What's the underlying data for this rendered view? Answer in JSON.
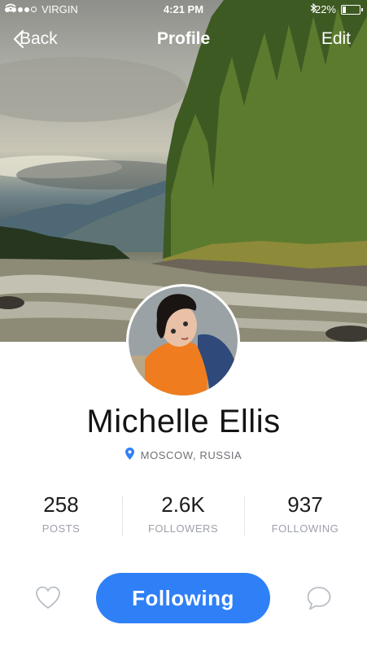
{
  "status_bar": {
    "carrier": "VIRGIN",
    "time": "4:21 PM",
    "battery": "22%",
    "battery_level": 0.22,
    "signal_dots_filled": 4,
    "signal_dots_total": 5,
    "icons": [
      "wifi-icon",
      "bluetooth-icon",
      "battery-icon"
    ]
  },
  "navbar": {
    "back_label": "Back",
    "title": "Profile",
    "edit_label": "Edit",
    "back_icon": "chevron-left-icon"
  },
  "profile": {
    "name": "Michelle Ellis",
    "location": "MOSCOW, RUSSIA",
    "location_icon": "map-pin-icon"
  },
  "stats": [
    {
      "value": "258",
      "label": "POSTS"
    },
    {
      "value": "2.6K",
      "label": "FOLLOWERS"
    },
    {
      "value": "937",
      "label": "FOLLOWING"
    }
  ],
  "actions": {
    "follow_label": "Following",
    "like_icon": "heart-icon",
    "message_icon": "chat-bubble-icon"
  },
  "colors": {
    "accent": "#2f80f6",
    "name_text": "#141414",
    "muted_text": "#9da1aa"
  }
}
